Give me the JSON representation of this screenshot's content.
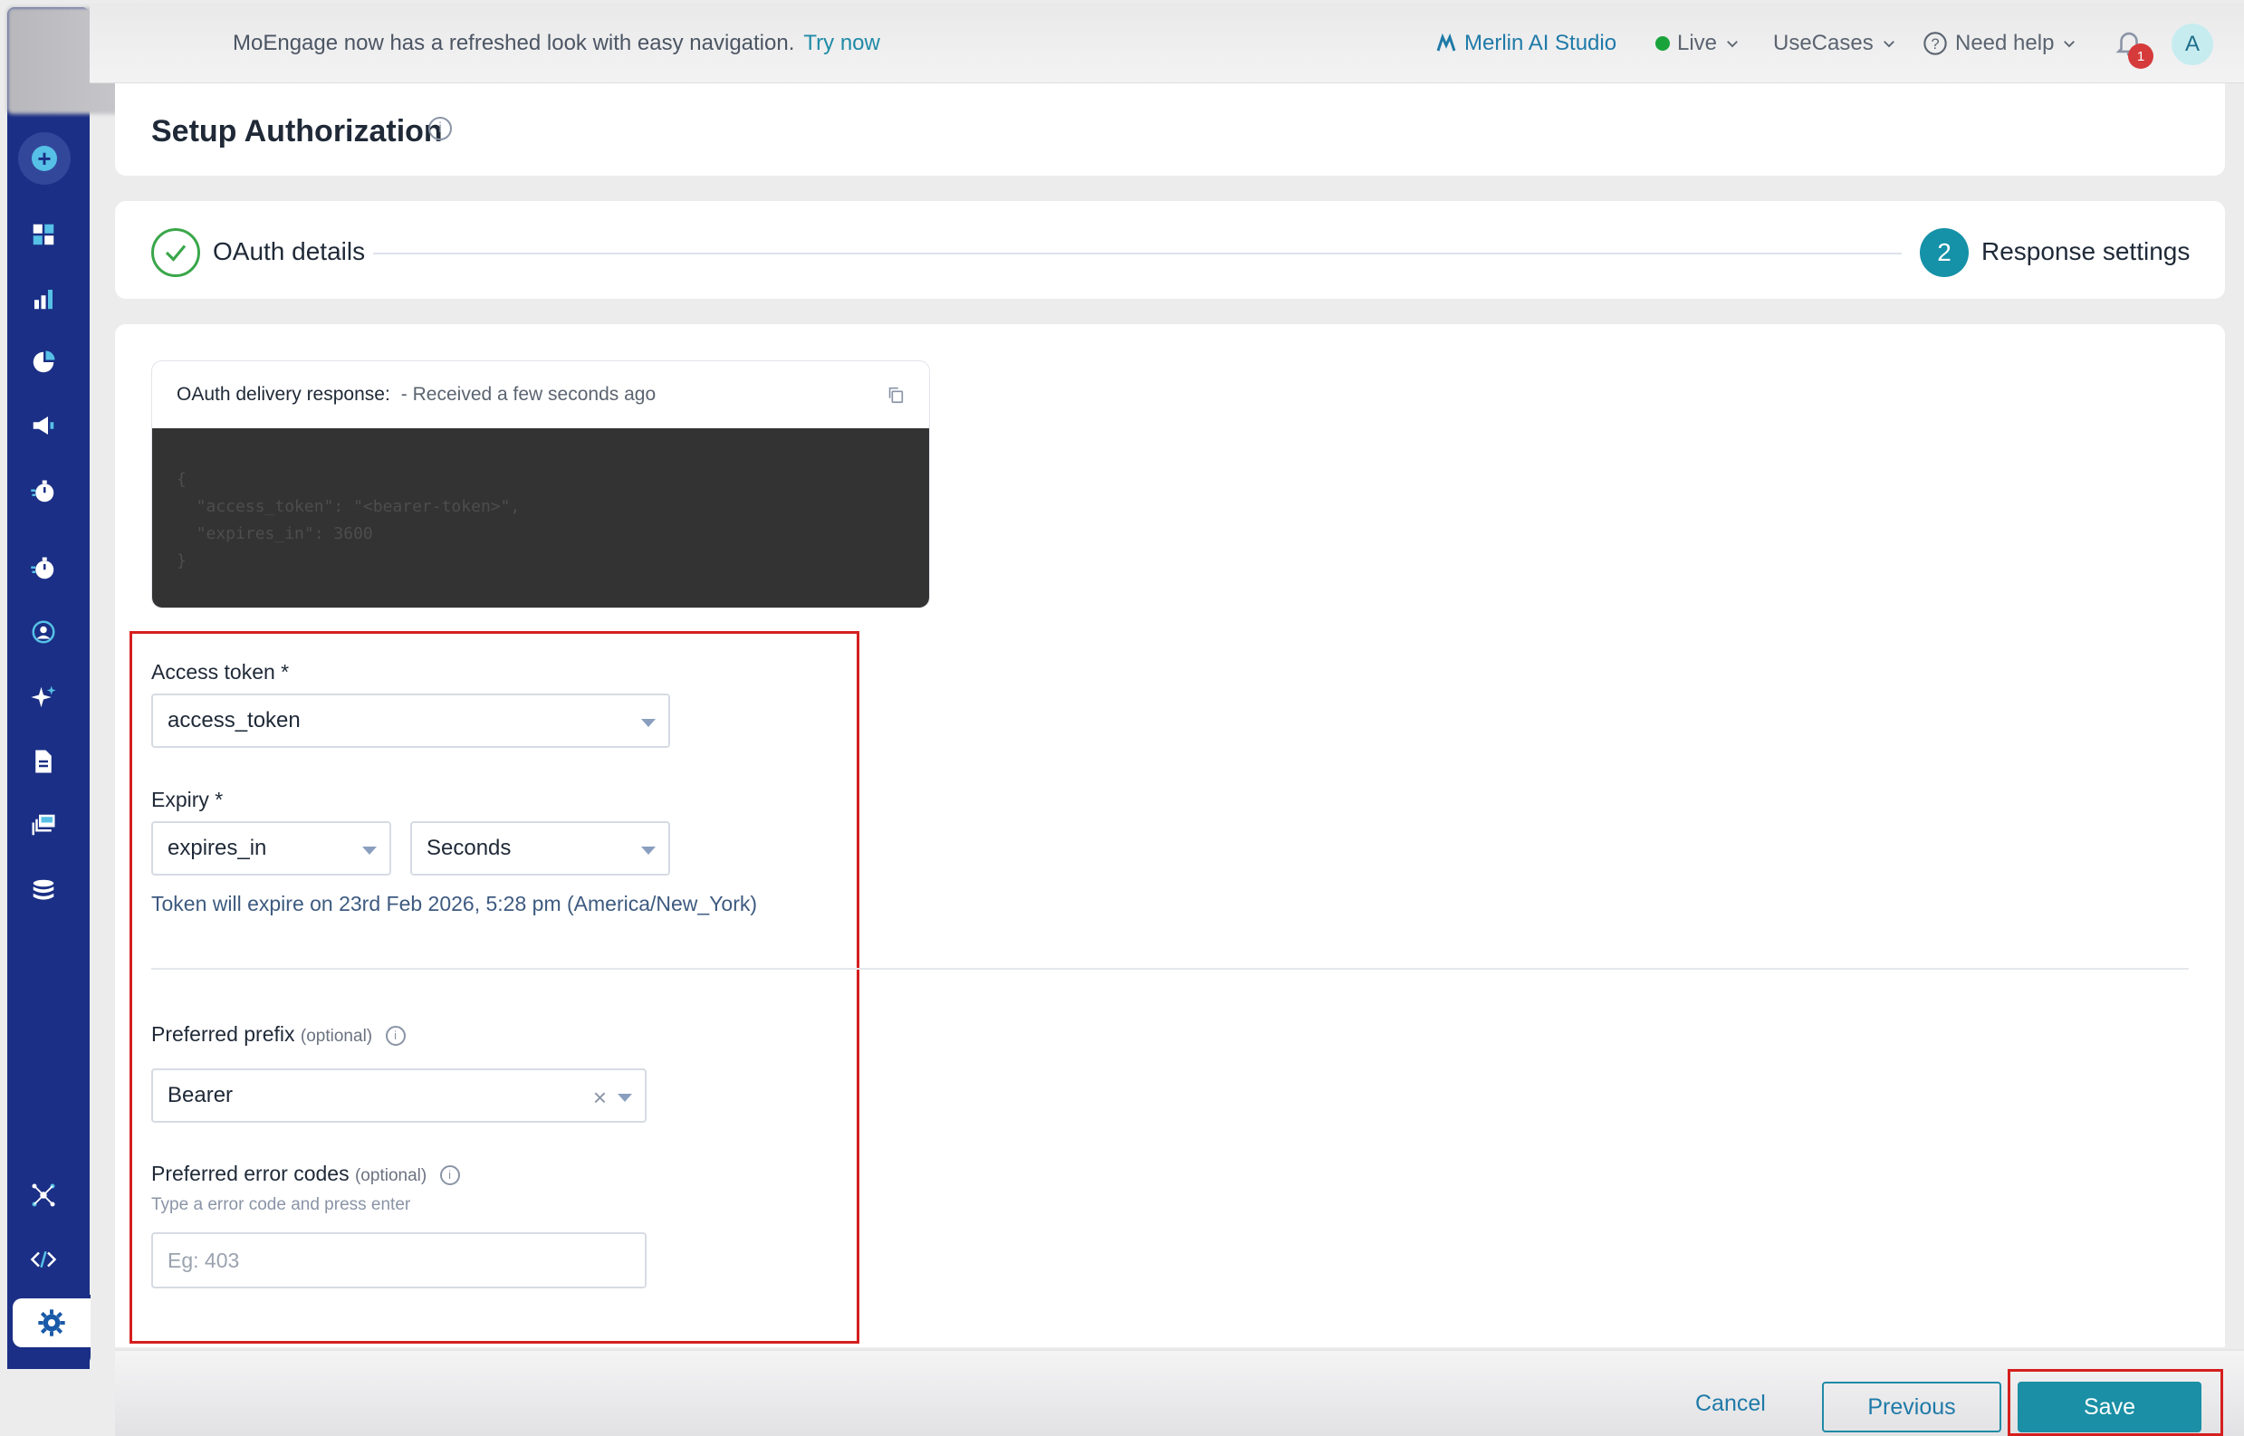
{
  "topbar": {
    "announcement": "MoEngage now has a refreshed look with easy navigation.",
    "announcement_link": "Try now",
    "merlin": "Merlin AI Studio",
    "live": "Live",
    "usecases": "UseCases",
    "need_help": "Need help",
    "notification_count": "1",
    "avatar_initial": "A"
  },
  "page": {
    "title": "Setup Authorization",
    "info_glyph": "i"
  },
  "stepper": {
    "step1_label": "OAuth details",
    "step2_number": "2",
    "step2_label": "Response settings"
  },
  "response": {
    "label": "OAuth delivery response:",
    "received": "- Received a few seconds ago",
    "code": "{\n  \"access_token\": \"<bearer-token>\",\n  \"expires_in\": 3600\n}"
  },
  "form": {
    "access_token_label": "Access token *",
    "access_token_value": "access_token",
    "expiry_label": "Expiry *",
    "expiry_field": "expires_in",
    "expiry_unit": "Seconds",
    "expiry_note": "Token will expire on 23rd Feb 2026, 5:28 pm (America/New_York)",
    "prefix_label": "Preferred prefix",
    "prefix_optional": "(optional)",
    "prefix_value": "Bearer",
    "error_codes_label": "Preferred error codes",
    "error_codes_optional": "(optional)",
    "error_codes_hint": "Type a error code and press enter",
    "error_codes_placeholder": "Eg: 403"
  },
  "footer": {
    "cancel": "Cancel",
    "previous": "Previous",
    "save": "Save"
  },
  "colors": {
    "sidebar": "#1a2f85",
    "accent": "#1a8fa5",
    "highlight": "#d51f1f",
    "success": "#3aa64a"
  },
  "icons": [
    "plus-icon",
    "dashboard-icon",
    "analytics-icon",
    "segments-icon",
    "campaign-icon",
    "timer-icon",
    "personalize-icon",
    "user-target-icon",
    "sparkle-icon",
    "document-icon",
    "content-icon",
    "database-icon",
    "network-icon",
    "code-icon",
    "gear-icon"
  ]
}
